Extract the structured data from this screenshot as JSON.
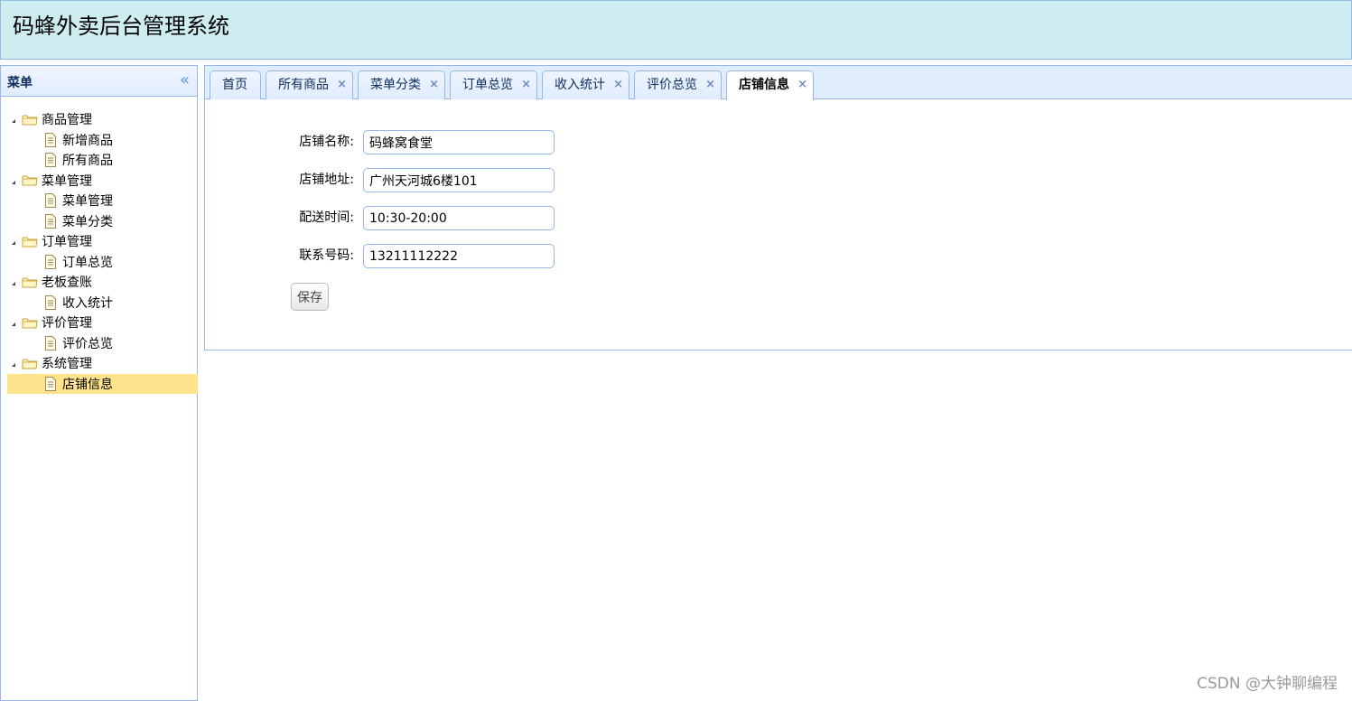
{
  "header": {
    "title": "码蜂外卖后台管理系统"
  },
  "sidebar": {
    "title": "菜单",
    "tree": [
      {
        "label": "商品管理",
        "children": [
          "新增商品",
          "所有商品"
        ]
      },
      {
        "label": "菜单管理",
        "children": [
          "菜单管理",
          "菜单分类"
        ]
      },
      {
        "label": "订单管理",
        "children": [
          "订单总览"
        ]
      },
      {
        "label": "老板查账",
        "children": [
          "收入统计"
        ]
      },
      {
        "label": "评价管理",
        "children": [
          "评价总览"
        ]
      },
      {
        "label": "系统管理",
        "children": [
          "店铺信息"
        ]
      }
    ],
    "selected": "店铺信息"
  },
  "tabs": [
    {
      "label": "首页",
      "closable": false
    },
    {
      "label": "所有商品",
      "closable": true
    },
    {
      "label": "菜单分类",
      "closable": true
    },
    {
      "label": "订单总览",
      "closable": true
    },
    {
      "label": "收入统计",
      "closable": true
    },
    {
      "label": "评价总览",
      "closable": true
    },
    {
      "label": "店铺信息",
      "closable": true,
      "active": true
    }
  ],
  "tab_close_glyph": "×",
  "form": {
    "fields": [
      {
        "label": "店铺名称:",
        "value": "码蜂窝食堂"
      },
      {
        "label": "店铺地址:",
        "value": "广州天河城6楼101"
      },
      {
        "label": "配送时间:",
        "value": "10:30-20:00"
      },
      {
        "label": "联系号码:",
        "value": "13211112222"
      }
    ],
    "save_label": "保存"
  },
  "collapse_glyph": "«",
  "watermark": "CSDN @大钟聊编程",
  "colors": {
    "header_bg": "#cdedf0",
    "border": "#95b8e7",
    "selected_bg": "#ffe48d",
    "tab_bar_bg": "#e0ecff"
  }
}
